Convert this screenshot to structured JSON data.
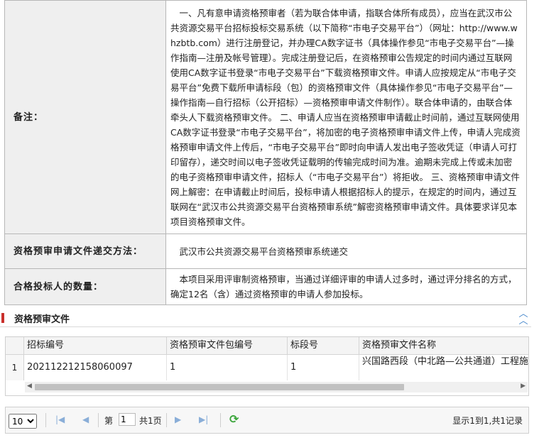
{
  "info_rows": [
    {
      "label": "备注：",
      "value": "一、凡有意申请资格预审者（若为联合体申请，指联合体所有成员），应当在武汉市公共资源交易平台招标投标交易系统（以下简称“市电子交易平台”）（网址：http://www.whzbtb.com）进行注册登记，并办理CA数字证书（具体操作参见“市电子交易平台”—操作指南—注册及帐号管理）。完成注册登记后，在资格预审公告规定的时间内通过互联网使用CA数字证书登录“市电子交易平台”下载资格预审文件。申请人应按规定从“市电子交易平台”免费下载所申请标段（包）的资格预审文件（具体操作参见“市电子交易平台”—操作指南—自行招标（公开招标）—资格预审申请文件制作）。联合体申请的，由联合体牵头人下载资格预审文件。 二、申请人应当在资格预审申请截止时间前，通过互联网使用CA数字证书登录“市电子交易平台”，将加密的电子资格预审申请文件上传，申请人完成资格预审申请文件上传后，“市电子交易平台”即时向申请人发出电子签收凭证（申请人可打印留存），递交时间以电子签收凭证载明的传输完成时间为准。逾期未完成上传或未加密的电子资格预审申请文件，招标人（“市电子交易平台”）将拒收。 三、资格预审申请文件网上解密：在申请截止时间后，投标申请人根据招标人的提示，在规定的时间内，通过互联网在“武汉市公共资源交易平台资格预审系统”解密资格预审申请文件。具体要求详见本项目资格预审文件。"
    },
    {
      "label": "资格预审申请文件递交方法：",
      "value": "武汉市公共资源交易平台资格预审系统递交"
    },
    {
      "label": "合格投标人的数量：",
      "value": "本项目采用评审制资格预审，当通过详细评审的申请人过多时，通过评分排名的方式，确定12名（含）通过资格预审的申请人参加投标。"
    }
  ],
  "section": {
    "title": "资格预审文件",
    "collapse_icon": "double-chevron-up-icon"
  },
  "grid": {
    "columns": [
      "招标编号",
      "资格预审文件包编号",
      "标段号",
      "资格预审文件名称"
    ],
    "rows": [
      {
        "num": "1",
        "cells": [
          "202112212158060097",
          "1",
          "1",
          "兴国路西段（中北路—公共通道）工程施工"
        ]
      }
    ]
  },
  "pager": {
    "page_size": "10",
    "page_size_options": [
      "10"
    ],
    "page_prefix": "第",
    "page_value": "1",
    "page_suffix": "共1页",
    "status": "显示1到1,共1记录"
  },
  "colors": {
    "accent_red": "#c9302c",
    "link_blue": "#3a7fc8",
    "refresh_green": "#3aa53a"
  }
}
